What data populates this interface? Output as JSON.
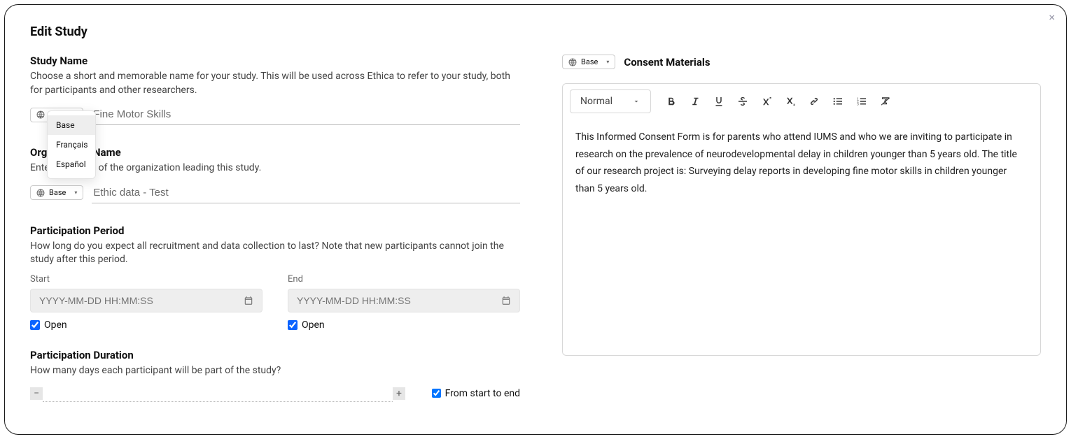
{
  "modal_title": "Edit Study",
  "close_label": "×",
  "lang_picker": {
    "selected": "Base",
    "options": [
      "Base",
      "Français",
      "Español"
    ]
  },
  "study_name": {
    "label": "Study Name",
    "help": "Choose a short and memorable name for your study. This will be used across Ethica to refer to your study, both for participants and other researchers.",
    "value": "Fine Motor Skills"
  },
  "org_name": {
    "label": "Organization Name",
    "help": "Enter the name of the organization leading this study.",
    "value": "Ethic data - Test"
  },
  "participation_period": {
    "label": "Participation Period",
    "help": "How long do you expect all recruitment and data collection to last? Note that new participants cannot join the study after this period.",
    "start_label": "Start",
    "end_label": "End",
    "placeholder": "YYYY-MM-DD HH:MM:SS",
    "open_label": "Open",
    "start_open_checked": true,
    "end_open_checked": true
  },
  "participation_duration": {
    "label": "Participation Duration",
    "help": "How many days each participant will be part of the study?",
    "from_label": "From start to end",
    "from_checked": true
  },
  "consent": {
    "title": "Consent Materials",
    "format_label": "Normal",
    "body": "This Informed Consent Form is for parents who attend IUMS and who we are inviting to participate in research on the prevalence of neurodevelopmental delay in children younger than 5 years old. The title of our research project is: Surveying delay reports in developing fine motor skills in children younger than 5 years old."
  }
}
